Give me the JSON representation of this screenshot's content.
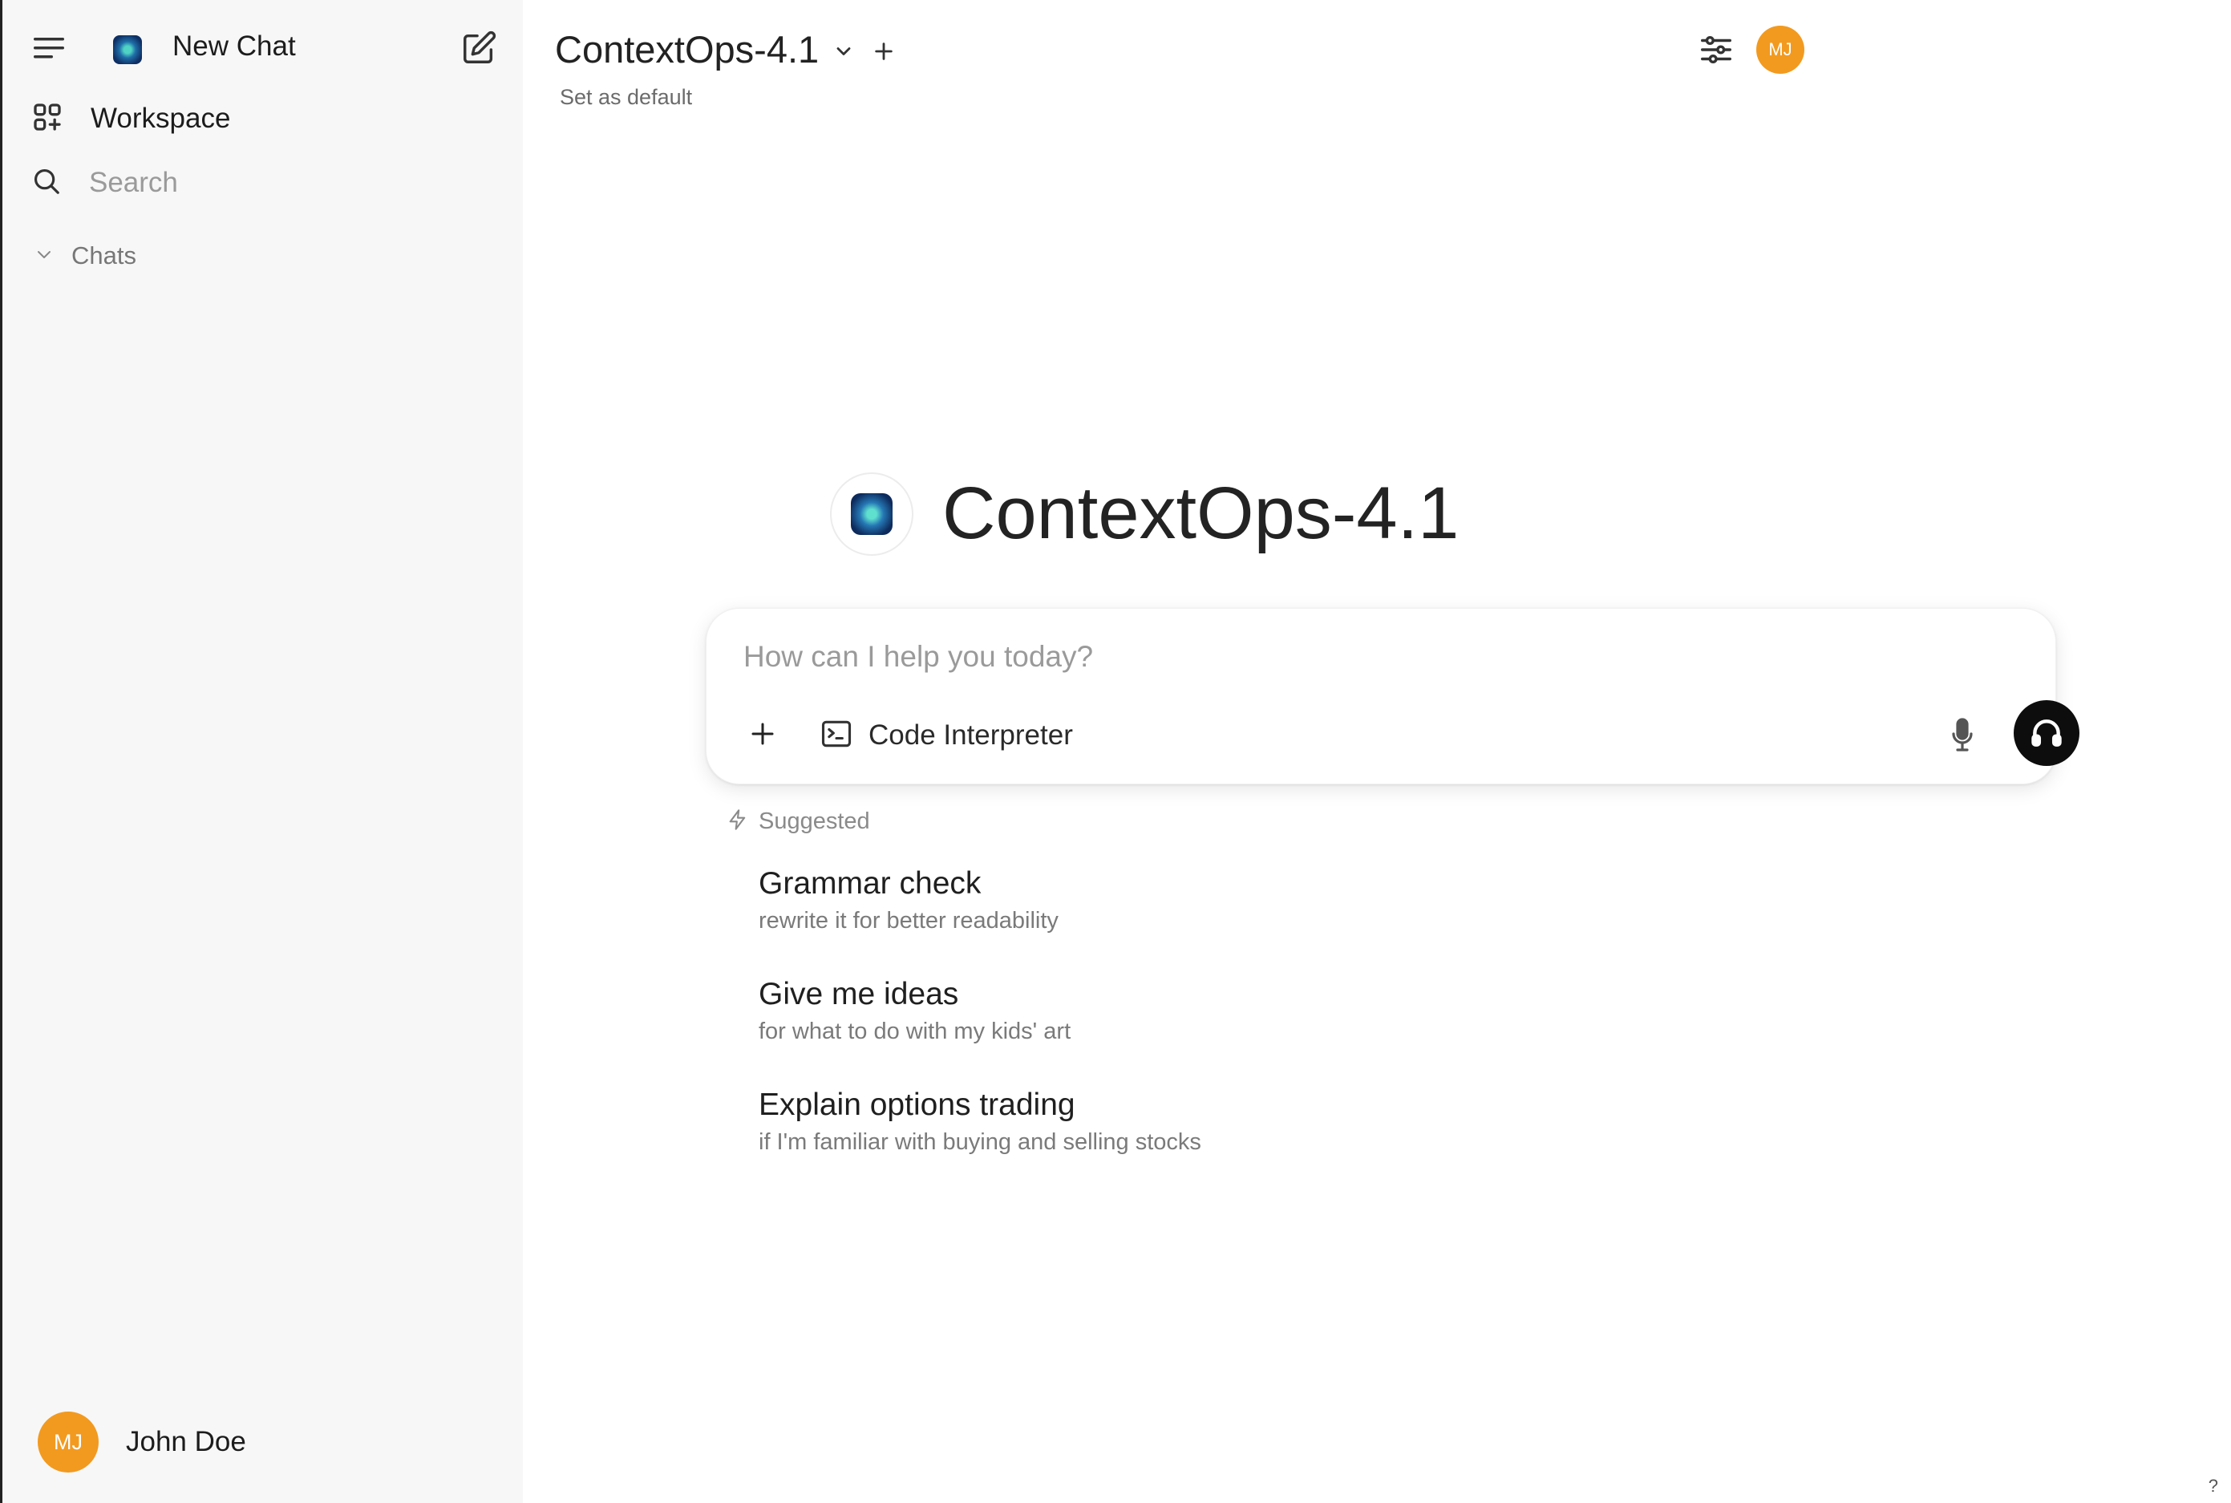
{
  "sidebar": {
    "new_chat_label": "New Chat",
    "workspace_label": "Workspace",
    "search_placeholder": "Search",
    "chats_label": "Chats",
    "user": {
      "initials": "MJ",
      "name": "John Doe"
    }
  },
  "header": {
    "model_name": "ContextOps-4.1",
    "set_default_label": "Set as default",
    "avatar_initials": "MJ"
  },
  "hero": {
    "title": "ContextOps-4.1"
  },
  "composer": {
    "placeholder": "How can I help you today?",
    "code_interpreter_label": "Code Interpreter"
  },
  "suggestions": {
    "heading": "Suggested",
    "items": [
      {
        "title": "Grammar check",
        "subtitle": "rewrite it for better readability"
      },
      {
        "title": "Give me ideas",
        "subtitle": "for what to do with my kids' art"
      },
      {
        "title": "Explain options trading",
        "subtitle": "if I'm familiar with buying and selling stocks"
      }
    ]
  },
  "footer": {
    "help_label": "?"
  },
  "colors": {
    "avatar": "#f29a1f",
    "voice_button": "#0d0d0d",
    "sidebar_bg": "#f7f7f7"
  },
  "icons": [
    "menu-icon",
    "app-logo-icon",
    "edit-icon",
    "workspace-icon",
    "search-icon",
    "chevron-down-icon",
    "plus-icon",
    "settings-sliders-icon",
    "terminal-icon",
    "microphone-icon",
    "headphones-icon",
    "bolt-icon"
  ]
}
